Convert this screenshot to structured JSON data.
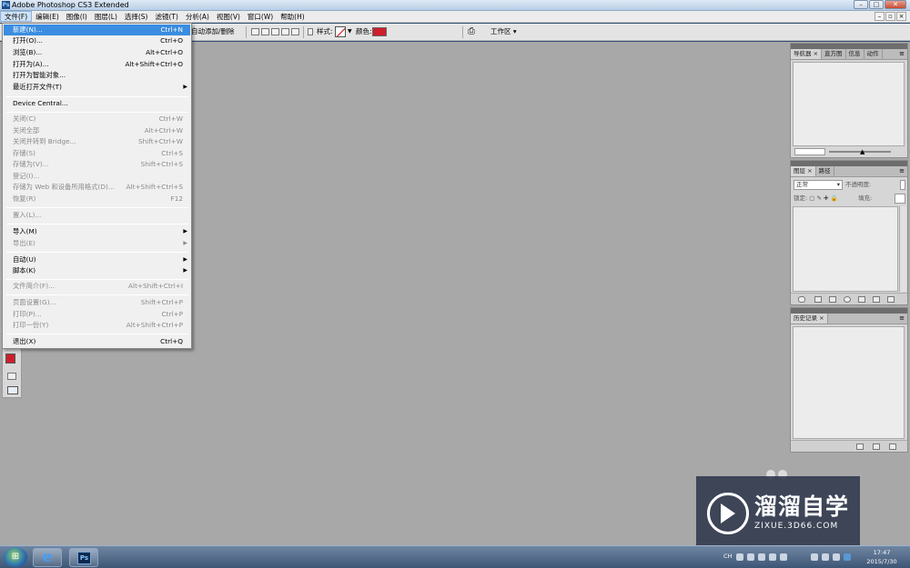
{
  "window": {
    "title": "Adobe Photoshop CS3 Extended",
    "app_icon": "Ps"
  },
  "menubar": {
    "items": [
      "文件(F)",
      "编辑(E)",
      "图像(I)",
      "图层(L)",
      "选择(S)",
      "滤镜(T)",
      "分析(A)",
      "视图(V)",
      "窗口(W)",
      "帮助(H)"
    ],
    "active": "文件(F)"
  },
  "options": {
    "auto_add_delete": "自动添加/删除",
    "style_label": "样式:",
    "color_label": "颜色:",
    "color_value": "#cc1f2e",
    "workspace": "工作区 ▾"
  },
  "file_menu": {
    "items": [
      {
        "label": "新建(N)...",
        "shortcut": "Ctrl+N",
        "state": "highlight"
      },
      {
        "label": "打开(O)...",
        "shortcut": "Ctrl+O",
        "state": "enabled"
      },
      {
        "label": "浏览(B)...",
        "shortcut": "Alt+Ctrl+O",
        "state": "enabled"
      },
      {
        "label": "打开为(A)...",
        "shortcut": "Alt+Shift+Ctrl+O",
        "state": "enabled"
      },
      {
        "label": "打开为智能对象...",
        "shortcut": "",
        "state": "enabled"
      },
      {
        "label": "最近打开文件(T)",
        "shortcut": "",
        "state": "submenu"
      },
      {
        "label": "Device Central...",
        "shortcut": "",
        "state": "enabled"
      },
      {
        "label": "关闭(C)",
        "shortcut": "Ctrl+W",
        "state": "disabled"
      },
      {
        "label": "关闭全部",
        "shortcut": "Alt+Ctrl+W",
        "state": "disabled"
      },
      {
        "label": "关闭并转到 Bridge...",
        "shortcut": "Shift+Ctrl+W",
        "state": "disabled"
      },
      {
        "label": "存储(S)",
        "shortcut": "Ctrl+S",
        "state": "disabled"
      },
      {
        "label": "存储为(V)...",
        "shortcut": "Shift+Ctrl+S",
        "state": "disabled"
      },
      {
        "label": "登记(I)...",
        "shortcut": "",
        "state": "disabled"
      },
      {
        "label": "存储为 Web 和设备所用格式(D)...",
        "shortcut": "Alt+Shift+Ctrl+S",
        "state": "disabled"
      },
      {
        "label": "恢复(R)",
        "shortcut": "F12",
        "state": "disabled"
      },
      {
        "label": "置入(L)...",
        "shortcut": "",
        "state": "disabled"
      },
      {
        "label": "导入(M)",
        "shortcut": "",
        "state": "submenu"
      },
      {
        "label": "导出(E)",
        "shortcut": "",
        "state": "submenu-disabled"
      },
      {
        "label": "自动(U)",
        "shortcut": "",
        "state": "submenu"
      },
      {
        "label": "脚本(K)",
        "shortcut": "",
        "state": "submenu"
      },
      {
        "label": "文件简介(F)...",
        "shortcut": "Alt+Shift+Ctrl+I",
        "state": "disabled"
      },
      {
        "label": "页面设置(G)...",
        "shortcut": "Shift+Ctrl+P",
        "state": "disabled"
      },
      {
        "label": "打印(P)...",
        "shortcut": "Ctrl+P",
        "state": "disabled"
      },
      {
        "label": "打印一份(Y)",
        "shortcut": "Alt+Shift+Ctrl+P",
        "state": "disabled"
      },
      {
        "label": "退出(X)",
        "shortcut": "Ctrl+Q",
        "state": "enabled"
      }
    ]
  },
  "panels": {
    "navigator": {
      "tabs": [
        "导航器",
        "直方图",
        "信息",
        "动作"
      ]
    },
    "layers": {
      "tabs": [
        "图层",
        "路径"
      ],
      "blend_mode": "正常",
      "opacity_label": "不透明度:",
      "lock_label": "锁定:",
      "fill_label": "填充:"
    },
    "history": {
      "tabs": [
        "历史记录"
      ]
    }
  },
  "taskbar": {
    "ps_label": "Ps",
    "ie_label": "e",
    "lang": "CH",
    "time": "17:47",
    "date": "2015/7/30"
  },
  "watermark": {
    "brand": "溜溜自学",
    "url": "ZIXUE.3D66.COM"
  },
  "colors": {
    "foreground": "#cc1f2e",
    "highlight": "#3a8de0",
    "canvas": "#a8a8a8"
  }
}
